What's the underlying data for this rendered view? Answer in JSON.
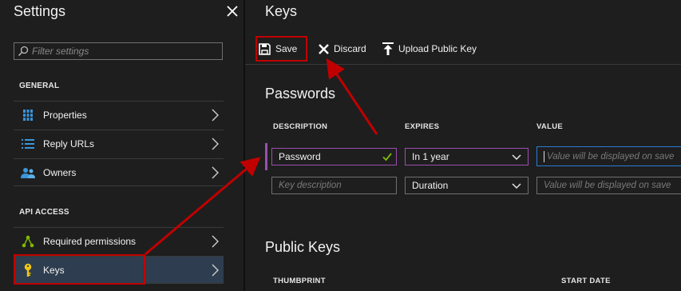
{
  "left_panel": {
    "title": "Settings",
    "search_placeholder": "Filter settings",
    "sections": [
      {
        "header": "GENERAL",
        "items": [
          {
            "label": "Properties",
            "icon": "properties-icon"
          },
          {
            "label": "Reply URLs",
            "icon": "list-icon"
          },
          {
            "label": "Owners",
            "icon": "owners-icon"
          }
        ]
      },
      {
        "header": "API ACCESS",
        "items": [
          {
            "label": "Required permissions",
            "icon": "permissions-icon"
          },
          {
            "label": "Keys",
            "icon": "key-icon",
            "active": true
          }
        ]
      }
    ]
  },
  "right_panel": {
    "title": "Keys",
    "toolbar": {
      "save": "Save",
      "discard": "Discard",
      "upload": "Upload Public Key"
    },
    "passwords": {
      "title": "Passwords",
      "columns": [
        "DESCRIPTION",
        "EXPIRES",
        "VALUE"
      ],
      "rows": [
        {
          "description": "Password",
          "expires": "In 1 year",
          "value_placeholder": "Value will be displayed on save"
        },
        {
          "description_placeholder": "Key description",
          "expires": "Duration",
          "value_placeholder": "Value will be displayed on save"
        }
      ]
    },
    "public_keys": {
      "title": "Public Keys",
      "columns": [
        "THUMBPRINT",
        "START DATE"
      ]
    }
  },
  "colors": {
    "accent_purple": "#9b4fb0",
    "focus_blue": "#2a7bd5",
    "annotation_red": "#c00000",
    "check_green": "#7fba00",
    "key_yellow": "#f2c811",
    "icon_blue": "#3a96dd",
    "icon_green": "#7fba00"
  }
}
